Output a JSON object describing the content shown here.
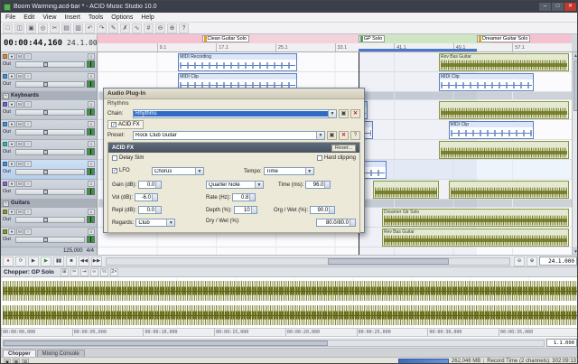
{
  "window": {
    "title": "Boom Warming.acd-bar * - ACID Music Studio 10.0"
  },
  "menu": [
    "File",
    "Edit",
    "View",
    "Insert",
    "Tools",
    "Options",
    "Help"
  ],
  "toolbar": [
    {
      "name": "new-project-icon",
      "glyph": "□"
    },
    {
      "name": "open-icon",
      "glyph": "◫"
    },
    {
      "name": "save-icon",
      "glyph": "▣"
    },
    {
      "name": "render-icon",
      "glyph": "◎"
    },
    {
      "name": "cut-icon",
      "glyph": "✂"
    },
    {
      "name": "copy-icon",
      "glyph": "▤"
    },
    {
      "name": "paste-icon",
      "glyph": "▥"
    },
    {
      "name": "undo-icon",
      "glyph": "↶"
    },
    {
      "name": "redo-icon",
      "glyph": "↷"
    },
    {
      "name": "draw-tool-icon",
      "glyph": "✎"
    },
    {
      "name": "erase-tool-icon",
      "glyph": "✗"
    },
    {
      "name": "envelope-tool-icon",
      "glyph": "∿"
    },
    {
      "name": "snap-icon",
      "glyph": "#"
    },
    {
      "name": "zoom-out-icon",
      "glyph": "⊖"
    },
    {
      "name": "zoom-in-icon",
      "glyph": "⊕"
    },
    {
      "name": "help-icon",
      "glyph": "?"
    }
  ],
  "transport_display": {
    "time": "00:00:44,160",
    "beats": "24.1.000"
  },
  "markers": [
    {
      "label": "Clean Guitar Solo",
      "style": "left:22%;--mk:#e0a020"
    },
    {
      "label": "GP Solo",
      "style": "left:55%;--mk:#50a050"
    },
    {
      "label": "Dreamer Guitar Solo",
      "style": "left:80%;--mk:#e0a020"
    }
  ],
  "ruler_ticks": [
    {
      "label": "9.1",
      "style": "left:12.5%"
    },
    {
      "label": "17.1",
      "style": "left:25%"
    },
    {
      "label": "25.1",
      "style": "left:37.5%"
    },
    {
      "label": "33.1",
      "style": "left:50%"
    },
    {
      "label": "41.1",
      "style": "left:62.5%"
    },
    {
      "label": "49.1",
      "style": "left:75%"
    },
    {
      "label": "57.1",
      "style": "left:87.5%"
    }
  ],
  "track_rows": [
    {
      "cls": "track",
      "out": "Out",
      "style": "--chip:#d98a3a"
    },
    {
      "cls": "track",
      "out": "Out",
      "style": "--chip:#4a8fd4"
    },
    {
      "cls": "group",
      "label": "Keyboards"
    },
    {
      "cls": "track",
      "out": "Out",
      "style": "--chip:#7a5fd0"
    },
    {
      "cls": "track",
      "out": "Out",
      "style": "--chip:#4a8fd4"
    },
    {
      "cls": "track",
      "out": "Out",
      "style": "--chip:#3ab0b8"
    },
    {
      "cls": "track selected",
      "out": "Out",
      "style": "--chip:#4a8fd4"
    },
    {
      "cls": "track",
      "out": "Out",
      "style": "--chip:#8a68c8"
    },
    {
      "cls": "group",
      "label": "Guitars"
    },
    {
      "cls": "track",
      "out": "Out",
      "style": "--chip:#8a9a2a"
    },
    {
      "cls": "track",
      "out": "Out",
      "style": "--chip:#8a9a2a"
    }
  ],
  "tempo": {
    "bpm": "125,000",
    "sig": "4/4"
  },
  "clips": [
    {
      "cls": "midi",
      "label": "MIDI Recording",
      "style": "left:17%;width:25%;top:1px"
    },
    {
      "cls": "audio",
      "label": "Rev Bas Guitar",
      "style": "left:72%;width:27.5%;top:1px"
    },
    {
      "cls": "midi",
      "label": "MIDI Clip",
      "style": "left:17%;width:25%;top:23px"
    },
    {
      "cls": "midi",
      "label": "MIDI Clip",
      "style": "left:72%;width:20%;top:23px"
    },
    {
      "cls": "midi",
      "label": "MIDI Clip",
      "style": "left:43%;width:14%;top:54px"
    },
    {
      "cls": "audio",
      "label": "",
      "style": "left:72%;width:27.5%;top:54px"
    },
    {
      "cls": "midi",
      "label": "MIDI Clip",
      "style": "left:45%;width:13%;top:76px"
    },
    {
      "cls": "midi",
      "label": "MIDI Clip",
      "style": "left:74%;width:18%;top:76px"
    },
    {
      "cls": "audio",
      "label": "",
      "style": "left:72%;width:27.5%;top:98px"
    },
    {
      "cls": "midi",
      "label": "MIDI Clip",
      "style": "left:45%;width:16%;top:120px"
    },
    {
      "cls": "audio",
      "label": "",
      "style": "left:58%;width:14%;top:142px"
    },
    {
      "cls": "audio",
      "label": "",
      "style": "left:74%;width:25.5%;top:142px"
    },
    {
      "cls": "audio",
      "label": "Dreamer Gtr Solo",
      "style": "left:60%;width:39.5%;top:173px"
    },
    {
      "cls": "audio",
      "label": "Rev Bas Guitar",
      "style": "left:60%;width:39.5%;top:195px"
    }
  ],
  "transport_buttons": [
    {
      "name": "record-button",
      "glyph": "●",
      "style": "--c:#c03030"
    },
    {
      "name": "loop-playback-button",
      "glyph": "⟳"
    },
    {
      "name": "play-from-start-button",
      "glyph": "▶"
    },
    {
      "name": "play-button",
      "glyph": "▶",
      "style": "--c:#2a8a2a"
    },
    {
      "name": "pause-button",
      "glyph": "▮▮"
    },
    {
      "name": "stop-button",
      "glyph": "■"
    },
    {
      "name": "go-to-start-button",
      "glyph": "◀◀"
    },
    {
      "name": "go-to-end-button",
      "glyph": "▶▶"
    }
  ],
  "scroll": {
    "position": "24.1.000"
  },
  "dialog": {
    "title": "Audio Plug-In",
    "bus_label": "Rhythms",
    "chain_label": "Chain:",
    "chain_value": "Rhythms",
    "chain_item": "ACID FX",
    "preset_label": "Preset:",
    "preset_value": "Rock Club Guitar",
    "fx": {
      "name": "ACID FX",
      "reset": "Reset...",
      "delay_check": "Delay Sim",
      "hard_clipping": "Hard clipping",
      "lfo_check": "LFO",
      "chorus_value": "Chorus",
      "tempo_label": "Tempo:",
      "tempo_value": "Time",
      "sync_value": "Quarter Note",
      "gain_label": "Gain (dB):",
      "gain_value": "0.0",
      "vol_label": "Vol (dB):",
      "vol_value": "-6.0",
      "repl_label": "Repl (dB):",
      "repl_value": "0.0",
      "rate_label": "Rate (Hz):",
      "rate_value": "0.8",
      "depth_label": "Depth (%):",
      "depth_value": "10",
      "time_label": "Time (ms):",
      "time_value": "96.0",
      "orgwet_label": "Org / Wet (%):",
      "orgwet_value": "90.0",
      "regards_label": "Regards:",
      "regards_value": "Club",
      "drywet_label": "Dry / Wet (%):",
      "drywet_value": "80.0/80.0"
    }
  },
  "chopper": {
    "title": "Chopper: GP Solo",
    "icons": [
      {
        "name": "chopper-grid-icon",
        "glyph": "⊞"
      },
      {
        "name": "chopper-chop-icon",
        "glyph": "✂"
      },
      {
        "name": "chopper-insert-icon",
        "glyph": "⇥"
      },
      {
        "name": "chopper-link-icon",
        "glyph": "∞"
      },
      {
        "name": "chopper-halve-icon",
        "glyph": "½"
      },
      {
        "name": "chopper-double-icon",
        "glyph": "2×"
      }
    ],
    "ticks": [
      {
        "label": "00:00:00,000",
        "style": "left:0%"
      },
      {
        "label": "00:00:05,000",
        "style": "left:12.3%"
      },
      {
        "label": "00:00:10,000",
        "style": "left:24.6%"
      },
      {
        "label": "00:00:15,000",
        "style": "left:36.9%"
      },
      {
        "label": "00:00:20,000",
        "style": "left:49.2%"
      },
      {
        "label": "00:00:25,000",
        "style": "left:61.5%"
      },
      {
        "label": "00:00:30,000",
        "style": "left:73.8%"
      },
      {
        "label": "00:00:35,000",
        "style": "left:86.1%"
      }
    ],
    "value": "1.1.000"
  },
  "tabs": [
    {
      "label": "Chopper",
      "cls": "active"
    },
    {
      "label": "Mixing Console",
      "cls": ""
    }
  ],
  "statusbar": {
    "icons": [
      {
        "name": "status-info-icon",
        "glyph": "▣"
      },
      {
        "name": "status-midi-icon",
        "glyph": "▦"
      },
      {
        "name": "status-audio-icon",
        "glyph": "▤"
      }
    ],
    "memory": "262,048 MB",
    "record_time": "Record Time (2 channels): 302:09:13"
  },
  "colors": {
    "selection_accent": "#316ac5",
    "audio_waveform": "#6e761e",
    "midi_clip": "#5a7ec0",
    "marker_pink": "#f4c2d0",
    "marker_green": "#cfe6c4",
    "titlebar": "#3a3f4a"
  }
}
